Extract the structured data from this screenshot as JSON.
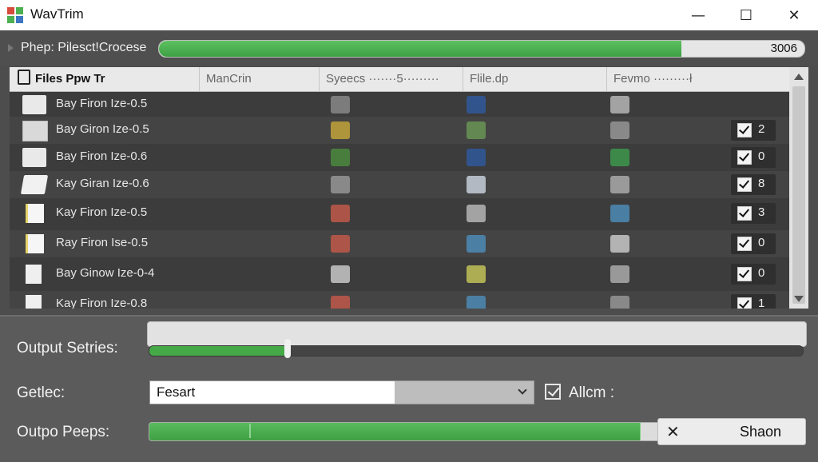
{
  "app": {
    "title": "WavTrim",
    "icon": "app-grid-icon",
    "controls": {
      "minimize": "—",
      "maximize": "☐",
      "close": "✕"
    }
  },
  "top_progress": {
    "label": "Phep: Pilesct!Crocese",
    "value_text": "3006",
    "fill_percent": 81,
    "color": "#4caf50"
  },
  "table": {
    "columns": [
      "Files Ppw Tr",
      "ManCrin",
      "Syeecs ·······5·········",
      "Flile.dp",
      "Fevmo ·········ł"
    ],
    "rows": [
      {
        "name": "Bay Firon Ize-0.5",
        "file_icon": "folder-icon",
        "checked": false,
        "count": ""
      },
      {
        "name": "Bay Giron Ize-0.5",
        "file_icon": "list-file-icon",
        "checked": true,
        "count": "2"
      },
      {
        "name": "Bay Firon Ize-0.6",
        "file_icon": "folder-icon",
        "checked": true,
        "count": "0"
      },
      {
        "name": "Kay Giran Ize-0.6",
        "file_icon": "open-folder-icon",
        "checked": true,
        "count": "8"
      },
      {
        "name": "Kay Firon Ize-0.5",
        "file_icon": "text-file-icon",
        "checked": true,
        "count": "3"
      },
      {
        "name": "Ray Firon Ise-0.5",
        "file_icon": "text-file-icon",
        "checked": true,
        "count": "0"
      },
      {
        "name": "Bay Ginow Ize-0-4",
        "file_icon": "document-icon",
        "checked": true,
        "count": "0"
      },
      {
        "name": "Kay Firon Ize-0.8",
        "file_icon": "document-icon",
        "checked": true,
        "count": "1"
      }
    ]
  },
  "bottom": {
    "output_label": "Output Setries:",
    "output_slider_percent": 21,
    "getlec_label": "Getlec:",
    "select_value": "Fesart",
    "allcm_label": "Allcm :",
    "allcm_checked": true,
    "peeps_label": "Outpo Peeps:",
    "peeps_percent": 96,
    "shaon_label": "Shaon",
    "shaon_icon": "close-x-icon"
  }
}
